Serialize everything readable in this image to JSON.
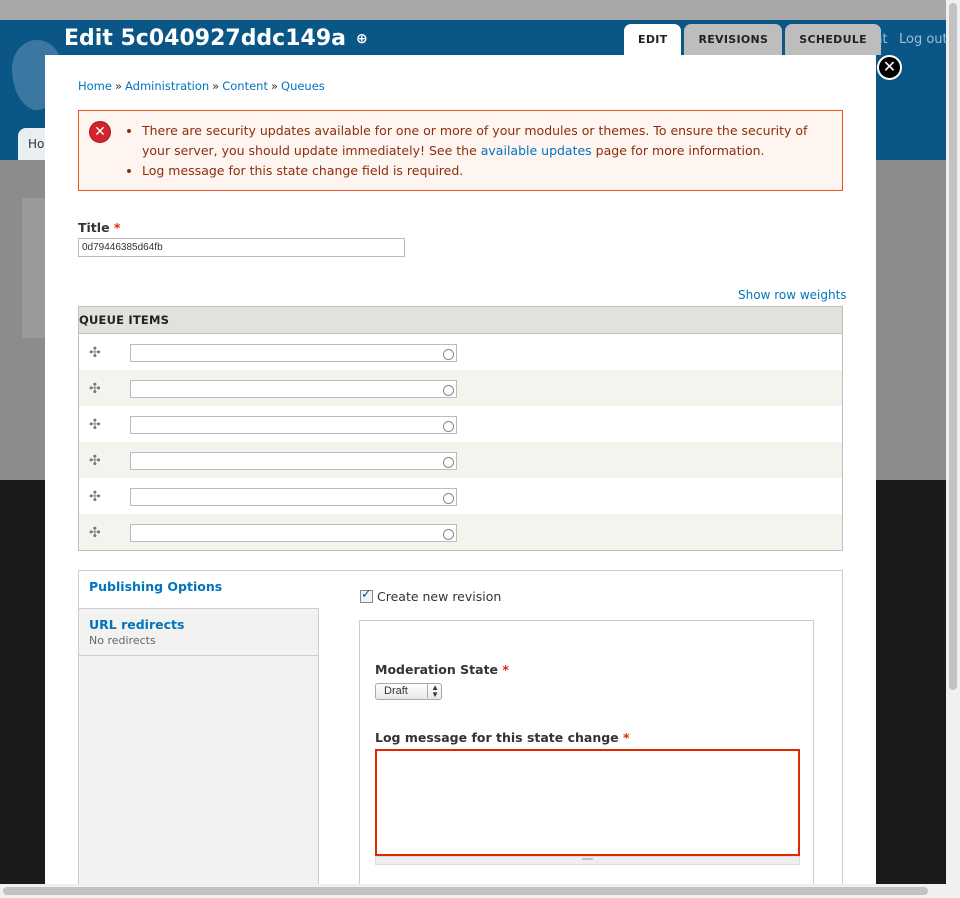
{
  "page": {
    "title": "Edit 5c040927ddc149a",
    "add_icon": "plus-circle-icon",
    "top_links": [
      "ount",
      "Log out"
    ],
    "home_tab": "Ho"
  },
  "tabs": [
    {
      "label": "EDIT",
      "active": true
    },
    {
      "label": "REVISIONS",
      "active": false
    },
    {
      "label": "SCHEDULE",
      "active": false
    }
  ],
  "breadcrumb": {
    "items": [
      "Home",
      "Administration",
      "Content",
      "Queues"
    ],
    "separator": "»"
  },
  "errors": {
    "icon": "error-icon",
    "msg1_pre": "There are security updates available for one or more of your modules or themes. To ensure the security of your server, you should update immediately! See the ",
    "msg1_link": "available updates",
    "msg1_post": " page for more information.",
    "msg2": "Log message for this state change field is required."
  },
  "title_field": {
    "label": "Title",
    "required": "*",
    "value": "0d79446385d64fb"
  },
  "queue": {
    "show_weights": "Show row weights",
    "header": "QUEUE ITEMS",
    "rows": [
      "",
      "",
      "",
      "",
      "",
      ""
    ]
  },
  "vertical_tabs": [
    {
      "title": "Publishing Options",
      "summary": ""
    },
    {
      "title": "URL redirects",
      "summary": "No redirects"
    }
  ],
  "revision": {
    "checkbox_label": "Create new revision",
    "checked": true
  },
  "moderation": {
    "label": "Moderation State",
    "required": "*",
    "selected": "Draft"
  },
  "log_message": {
    "label": "Log message for this state change",
    "required": "*",
    "value": ""
  },
  "colors": {
    "header_blue": "#0a5687",
    "link": "#0074bd",
    "error_border": "#ed541d",
    "required": "#e32700"
  }
}
